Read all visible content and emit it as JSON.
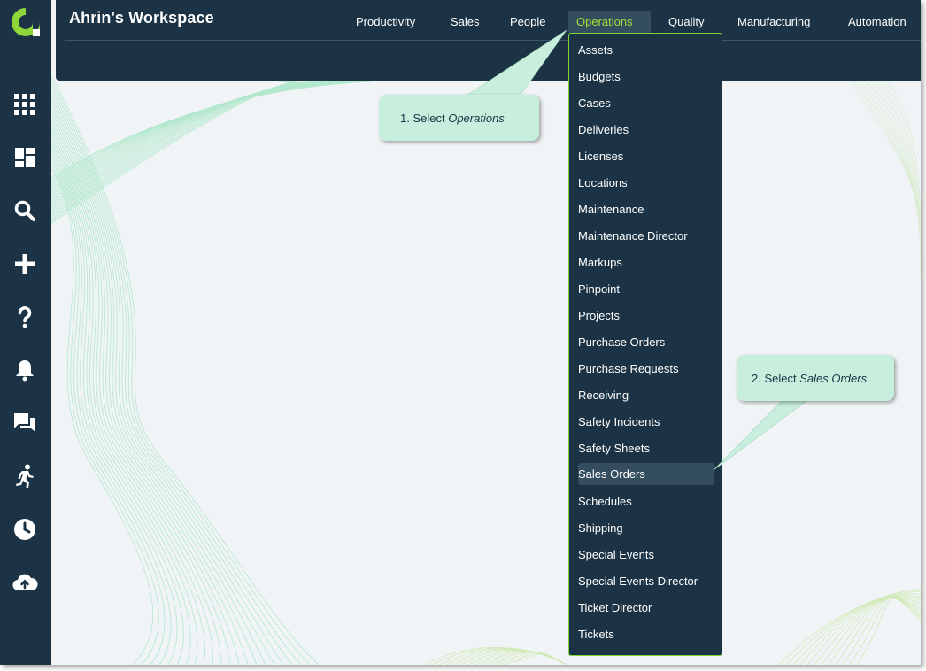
{
  "workspace": {
    "title": "Ahrin's Workspace"
  },
  "sidebar": {
    "items": [
      {
        "name": "apps-grid-icon"
      },
      {
        "name": "dashboard-icon"
      },
      {
        "name": "search-icon"
      },
      {
        "name": "add-icon"
      },
      {
        "name": "help-icon"
      },
      {
        "name": "notifications-bell-icon"
      },
      {
        "name": "chat-icon"
      },
      {
        "name": "activity-runner-icon"
      },
      {
        "name": "history-clock-icon"
      },
      {
        "name": "cloud-upload-icon"
      }
    ]
  },
  "nav": {
    "items": [
      "Productivity",
      "Sales",
      "People",
      "Operations",
      "Quality",
      "Manufacturing",
      "Automation"
    ],
    "active": "Operations"
  },
  "dropdown": {
    "items": [
      "Assets",
      "Budgets",
      "Cases",
      "Deliveries",
      "Licenses",
      "Locations",
      "Maintenance",
      "Maintenance Director",
      "Markups",
      "Pinpoint",
      "Projects",
      "Purchase Orders",
      "Purchase Requests",
      "Receiving",
      "Safety Incidents",
      "Safety Sheets",
      "Sales Orders",
      "Schedules",
      "Shipping",
      "Special Events",
      "Special Events Director",
      "Ticket Director",
      "Tickets"
    ],
    "highlighted": "Sales Orders"
  },
  "callouts": {
    "step1_prefix": "1. Select ",
    "step1_target": "Operations",
    "step2_prefix": "2. Select ",
    "step2_target": "Sales Orders"
  },
  "colors": {
    "navy": "#1b3344",
    "accent_green": "#9fe03a",
    "callout_bg": "#c8eedd",
    "background": "#f1f4f6"
  }
}
